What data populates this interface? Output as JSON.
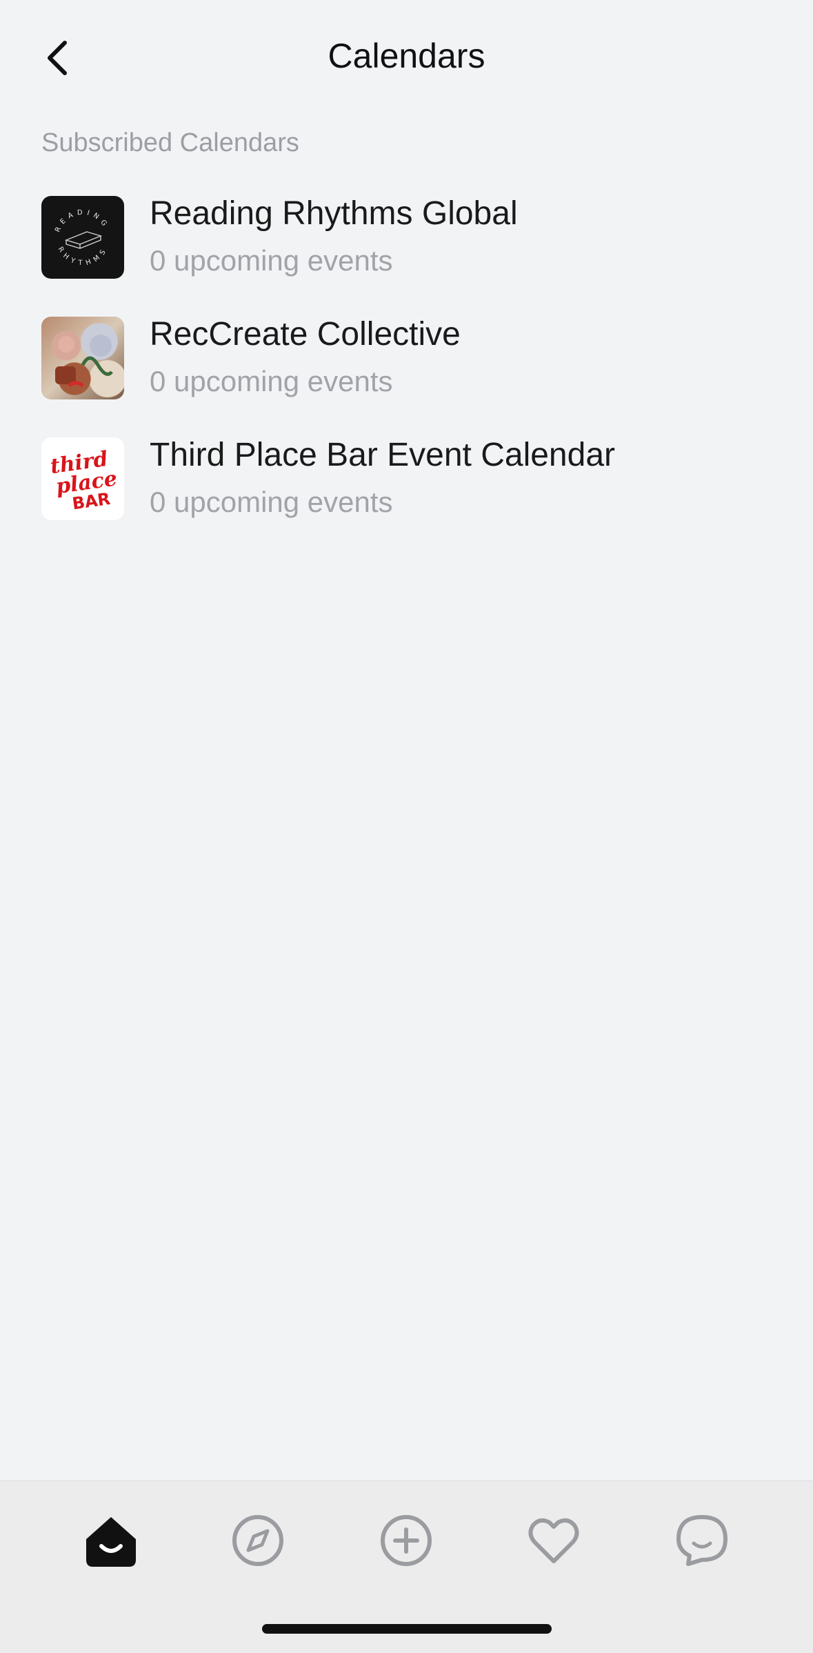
{
  "header": {
    "title": "Calendars",
    "back_icon": "chevron-left-icon"
  },
  "section": {
    "label": "Subscribed Calendars"
  },
  "calendars": [
    {
      "title": "Reading Rhythms Global",
      "subtitle": "0 upcoming events",
      "thumb_icon": "reading-rhythms-logo",
      "thumb_text_top": "READING",
      "thumb_text_bottom": "RHYTHMS"
    },
    {
      "title": "RecCreate Collective",
      "subtitle": "0 upcoming events",
      "thumb_icon": "collage-image"
    },
    {
      "title": "Third Place Bar Event Calendar",
      "subtitle": "0 upcoming events",
      "thumb_icon": "third-place-bar-logo",
      "thumb_text_1": "third",
      "thumb_text_2": "place",
      "thumb_text_3": "BAR"
    }
  ],
  "tabbar": {
    "tabs": [
      {
        "icon": "home-icon",
        "active": true
      },
      {
        "icon": "compass-icon",
        "active": false
      },
      {
        "icon": "plus-circle-icon",
        "active": false
      },
      {
        "icon": "heart-icon",
        "active": false
      },
      {
        "icon": "chat-bubble-icon",
        "active": false
      }
    ]
  },
  "colors": {
    "background": "#f2f3f5",
    "text_primary": "#1a1a1a",
    "text_secondary": "#a0a3a8",
    "tab_inactive": "#9a9ca0",
    "tab_active": "#111111",
    "brand_red": "#d9141b"
  }
}
